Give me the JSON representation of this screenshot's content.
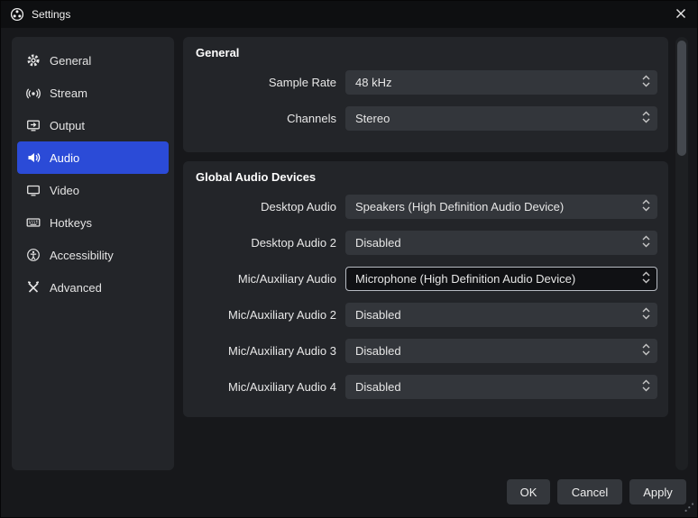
{
  "titlebar": {
    "title": "Settings"
  },
  "sidebar": {
    "items": [
      {
        "label": "General",
        "icon": "gear-icon"
      },
      {
        "label": "Stream",
        "icon": "broadcast-icon"
      },
      {
        "label": "Output",
        "icon": "output-icon"
      },
      {
        "label": "Audio",
        "icon": "speaker-icon",
        "selected": true
      },
      {
        "label": "Video",
        "icon": "monitor-icon"
      },
      {
        "label": "Hotkeys",
        "icon": "keyboard-icon"
      },
      {
        "label": "Accessibility",
        "icon": "accessibility-icon"
      },
      {
        "label": "Advanced",
        "icon": "tools-icon"
      }
    ]
  },
  "sections": {
    "general": {
      "title": "General",
      "rows": [
        {
          "label": "Sample Rate",
          "value": "48 kHz"
        },
        {
          "label": "Channels",
          "value": "Stereo"
        }
      ]
    },
    "global_audio": {
      "title": "Global Audio Devices",
      "rows": [
        {
          "label": "Desktop Audio",
          "value": "Speakers (High Definition Audio Device)"
        },
        {
          "label": "Desktop Audio 2",
          "value": "Disabled"
        },
        {
          "label": "Mic/Auxiliary Audio",
          "value": "Microphone (High Definition Audio Device)",
          "focused": true
        },
        {
          "label": "Mic/Auxiliary Audio 2",
          "value": "Disabled"
        },
        {
          "label": "Mic/Auxiliary Audio 3",
          "value": "Disabled"
        },
        {
          "label": "Mic/Auxiliary Audio 4",
          "value": "Disabled"
        }
      ]
    }
  },
  "footer": {
    "ok_label": "OK",
    "cancel_label": "Cancel",
    "apply_label": "Apply"
  },
  "colors": {
    "accent_blue": "#2b4bd7",
    "window_bg": "#17181b",
    "titlebar_bg": "#0e0f11",
    "panel_bg": "#232529",
    "control_bg": "#33363b",
    "focused_control_bg": "#101114",
    "focused_border": "#b7bbc2",
    "text": "#e8e8e8"
  }
}
